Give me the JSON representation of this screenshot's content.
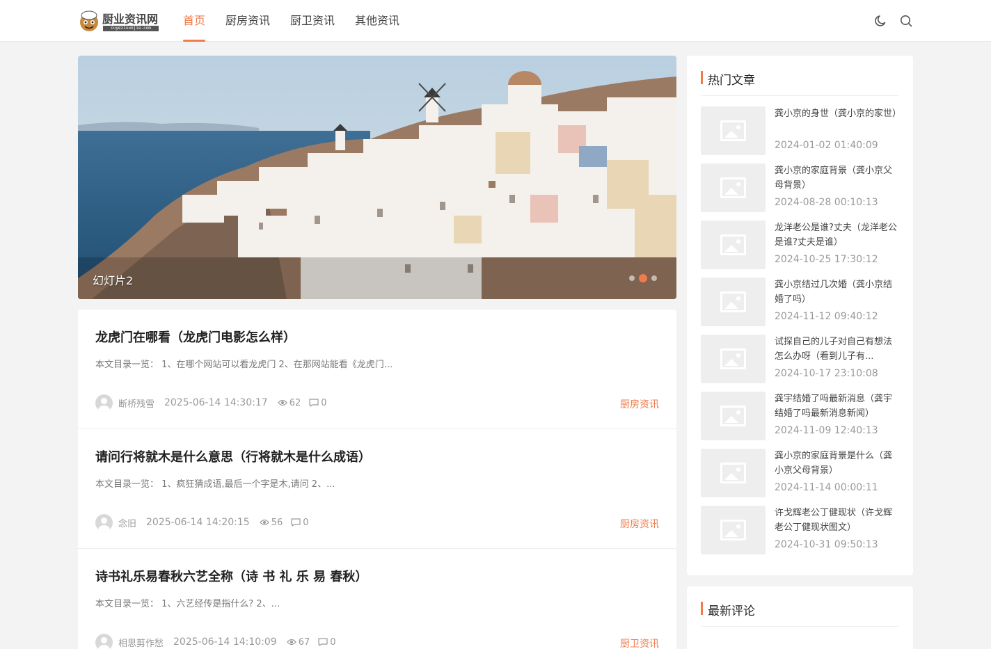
{
  "site": {
    "name": "厨业资讯网",
    "domain": "cuyezixunjie.com"
  },
  "nav": [
    {
      "label": "首页",
      "active": true
    },
    {
      "label": "厨房资讯",
      "active": false
    },
    {
      "label": "厨卫资讯",
      "active": false
    },
    {
      "label": "其他资讯",
      "active": false
    }
  ],
  "header_icons": [
    "moon-icon",
    "search-icon"
  ],
  "slider": {
    "caption": "幻灯片2",
    "slide_count": 3,
    "active_index": 2
  },
  "posts": [
    {
      "title": "龙虎门在哪看（龙虎门电影怎么样）",
      "excerpt": "本文目录一览：  1、在哪个网站可以看龙虎门 2、在那网站能看《龙虎门...",
      "author": "断桥残雪",
      "date": "2025-06-14 14:30:17",
      "views": "62",
      "comments": "0",
      "category": "厨房资讯"
    },
    {
      "title": "请问行将就木是什么意思（行将就木是什么成语）",
      "excerpt": "本文目录一览：  1、疯狂猜成语,最后一个字是木,请问 2、...",
      "author": "念旧",
      "date": "2025-06-14 14:20:15",
      "views": "56",
      "comments": "0",
      "category": "厨房资讯"
    },
    {
      "title": "诗书礼乐易春秋六艺全称（诗 书 礼 乐 易 春秋）",
      "excerpt": "本文目录一览：  1、六艺经传是指什么? 2、...",
      "author": "相思剪作愁",
      "date": "2025-06-14 14:10:09",
      "views": "67",
      "comments": "0",
      "category": "厨卫资讯"
    }
  ],
  "hot": {
    "title": "热门文章",
    "items": [
      {
        "title": "龚小京的身世（龚小京的家世）",
        "date": "2024-01-02 01:40:09"
      },
      {
        "title": "龚小京的家庭背景（龚小京父母背景）",
        "date": "2024-08-28 00:10:13"
      },
      {
        "title": "龙洋老公是谁?丈夫（龙洋老公是谁?丈夫是谁）",
        "date": "2024-10-25 17:30:12"
      },
      {
        "title": "龚小京结过几次婚（龚小京结婚了吗）",
        "date": "2024-11-12 09:40:12"
      },
      {
        "title": "试探自己的儿子对自己有想法怎么办呀（看到儿子有...",
        "date": "2024-10-17 23:10:08"
      },
      {
        "title": "龚宇结婚了吗最新消息（龚宇结婚了吗最新消息新闻）",
        "date": "2024-11-09 12:40:13"
      },
      {
        "title": "龚小京的家庭背景是什么（龚小京父母背景）",
        "date": "2024-11-14 00:00:11"
      },
      {
        "title": "许戈辉老公丁健现状（许戈辉老公丁健现状图文）",
        "date": "2024-10-31 09:50:13"
      }
    ]
  },
  "comments_widget": {
    "title": "最新评论"
  },
  "colors": {
    "accent": "#f07b4c",
    "background": "#f3f3f3"
  }
}
